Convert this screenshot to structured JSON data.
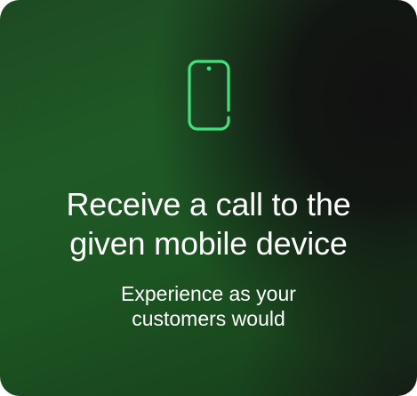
{
  "card": {
    "icon": "mobile-phone-icon",
    "accent_color": "#3fe27c",
    "title_lines": [
      "Receive a call to the",
      "given mobile device"
    ],
    "subtitle_lines": [
      "Experience as your",
      "customers would"
    ]
  }
}
